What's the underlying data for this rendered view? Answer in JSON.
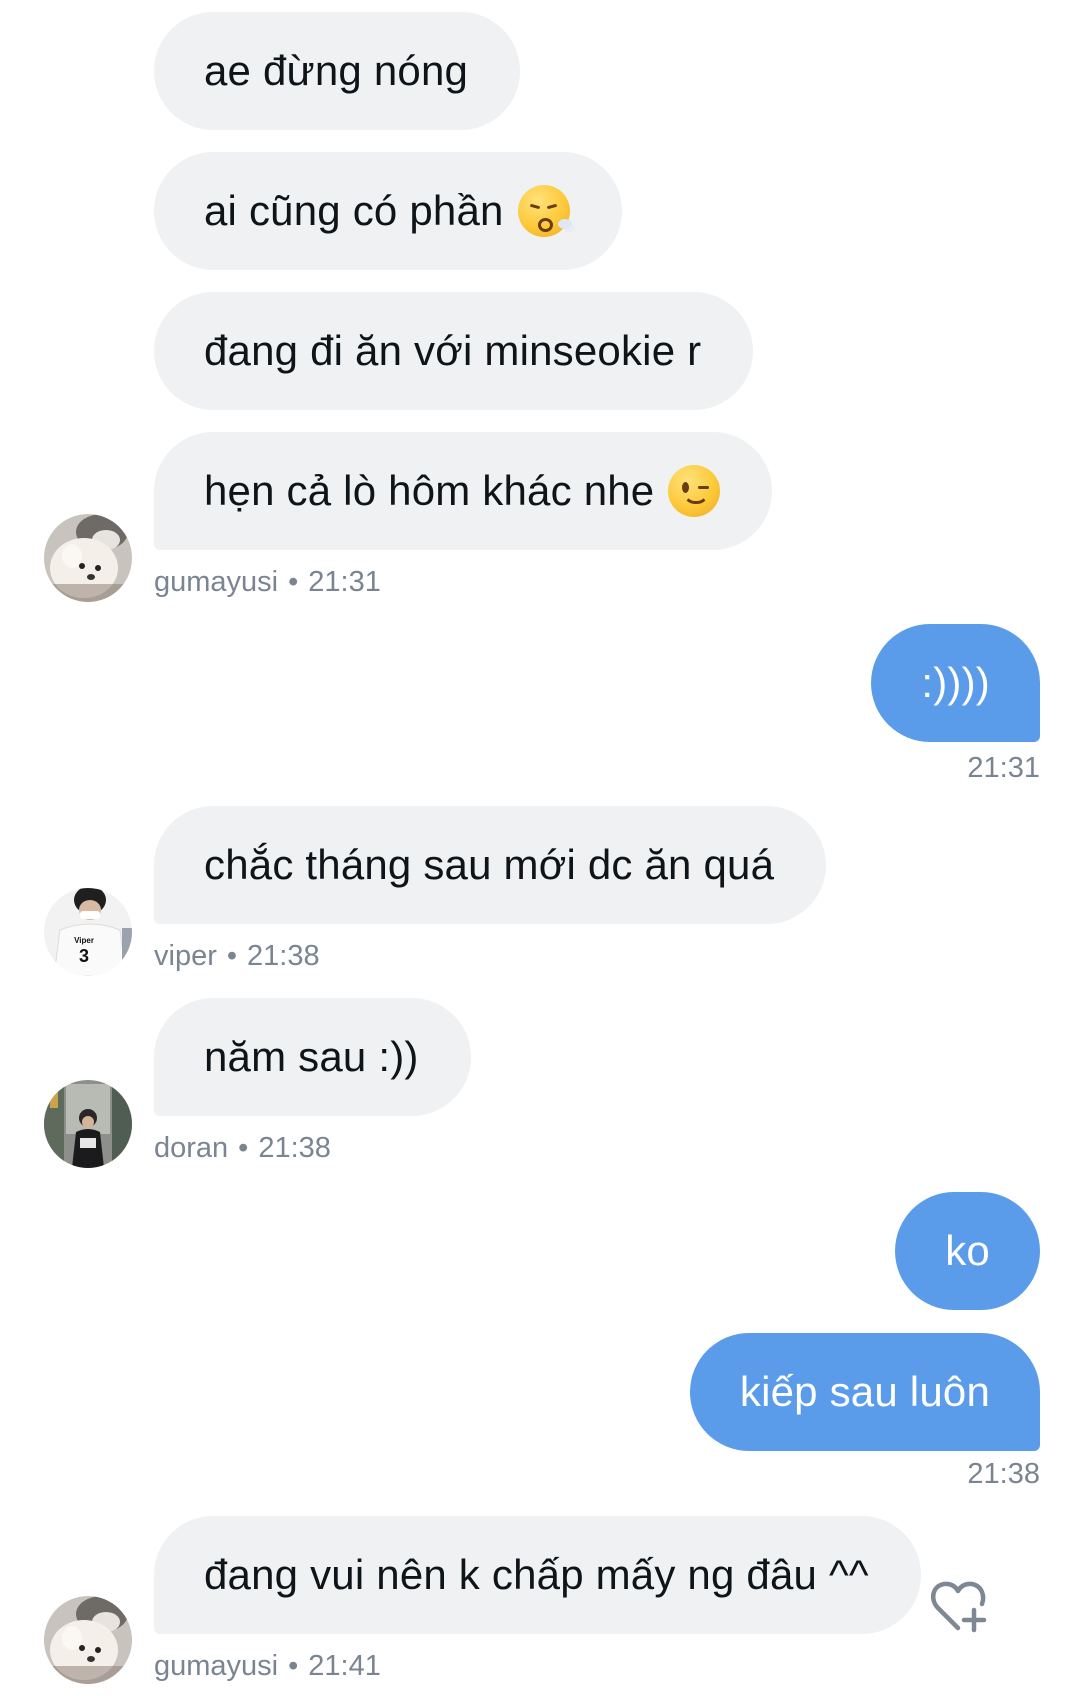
{
  "messages": {
    "m1": "ae đừng nóng",
    "m2": "ai cũng có phần",
    "m3": "đang đi ăn với minseokie r",
    "m4": "hẹn cả lò hôm khác nhe",
    "m5": ":))))",
    "m6": "chắc tháng sau mới dc ăn quá",
    "m7": "năm sau :))",
    "m8": "ko",
    "m9": "kiếp sau luôn",
    "m10": "đang vui nên k chấp mấy ng đâu ^^"
  },
  "meta": {
    "g1_user": "gumayusi",
    "g1_time": "21:31",
    "out1_time": "21:31",
    "viper_user": "viper",
    "viper_time": "21:38",
    "doran_user": "doran",
    "doran_time": "21:38",
    "out2_time": "21:38",
    "g2_user": "gumayusi",
    "g2_time": "21:41",
    "separator": "•"
  },
  "avatars": {
    "viper_jersey_name": "Viper",
    "viper_jersey_number": "3"
  },
  "emojis": {
    "m2": "face-exhaling-emoji",
    "m4": "winking-face-emoji"
  },
  "icons": {
    "react": "heart-plus-icon"
  },
  "colors": {
    "incoming_bubble": "#eff1f3",
    "outgoing_bubble": "#5b9cea",
    "meta_text": "#7a8591",
    "text": "#0f1419"
  }
}
